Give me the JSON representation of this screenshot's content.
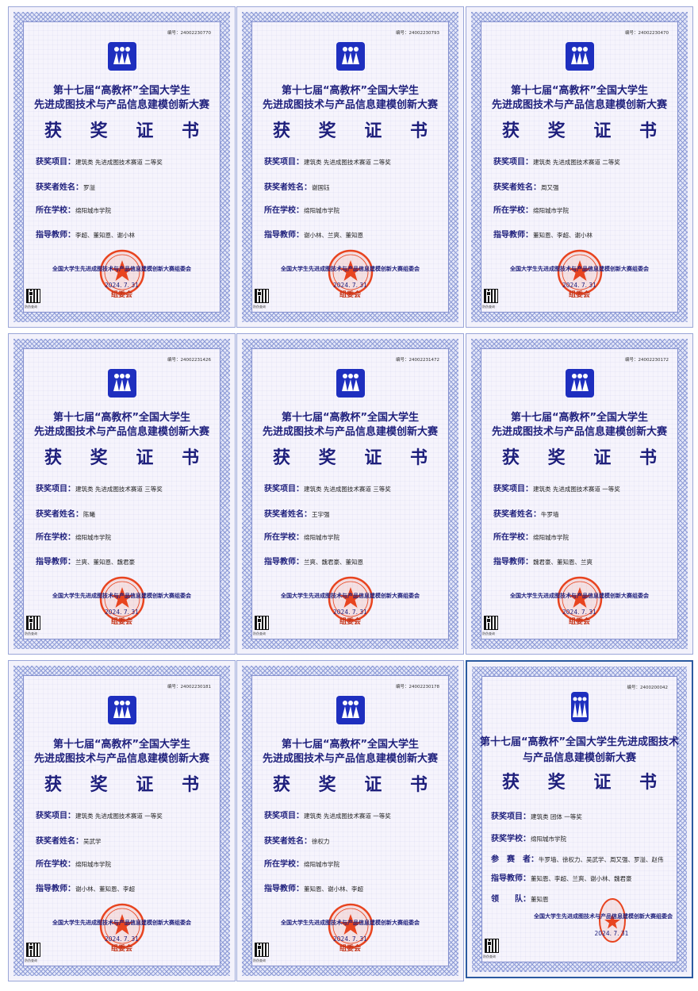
{
  "certificates": [
    {
      "serial": "编号：24002230770",
      "title1": "第十七届“高教杯”全国大学生",
      "title2": "先进成图技术与产品信息建模创新大赛",
      "heading": "获 奖 证 书",
      "item_label": "获奖项目：",
      "item_value": "建筑类 先进成图技术赛道 二等奖",
      "name_label": "获奖者姓名：",
      "name_value": "罗溢",
      "school_label": "所在学校：",
      "school_value": "绵阳城市学院",
      "teacher_label": "指导教师：",
      "teacher_value": "李超、董知恩、谢小林",
      "org": "全国大学生先进成图技术与产品信息建模创新大赛组委会",
      "date": "2024. 7. 31",
      "seal_text": "组委会",
      "qr_label": "防伪查询"
    },
    {
      "serial": "编号：24002230793",
      "title1": "第十七届“高教杯”全国大学生",
      "title2": "先进成图技术与产品信息建模创新大赛",
      "heading": "获 奖 证 书",
      "item_label": "获奖项目：",
      "item_value": "建筑类 先进成图技术赛道 二等奖",
      "name_label": "获奖者姓名：",
      "name_value": "谢国钰",
      "school_label": "所在学校：",
      "school_value": "绵阳城市学院",
      "teacher_label": "指导教师：",
      "teacher_value": "谢小林、兰爽、董知恩",
      "org": "全国大学生先进成图技术与产品信息建模创新大赛组委会",
      "date": "2024. 7. 31",
      "seal_text": "组委会",
      "qr_label": "防伪查询"
    },
    {
      "serial": "编号：24002230470",
      "title1": "第十七届“高教杯”全国大学生",
      "title2": "先进成图技术与产品信息建模创新大赛",
      "heading": "获 奖 证 书",
      "item_label": "获奖项目：",
      "item_value": "建筑类 先进成图技术赛道 二等奖",
      "name_label": "获奖者姓名：",
      "name_value": "周又强",
      "school_label": "所在学校：",
      "school_value": "绵阳城市学院",
      "teacher_label": "指导教师：",
      "teacher_value": "董知恩、李超、谢小林",
      "org": "全国大学生先进成图技术与产品信息建模创新大赛组委会",
      "date": "2024. 7. 31",
      "seal_text": "组委会",
      "qr_label": "防伪查询"
    },
    {
      "serial": "编号：24002231426",
      "title1": "第十七届“高教杯”全国大学生",
      "title2": "先进成图技术与产品信息建模创新大赛",
      "heading": "获 奖 证 书",
      "item_label": "获奖项目：",
      "item_value": "建筑类 先进成图技术赛道 三等奖",
      "name_label": "获奖者姓名：",
      "name_value": "陈曦",
      "school_label": "所在学校：",
      "school_value": "绵阳城市学院",
      "teacher_label": "指导教师：",
      "teacher_value": "兰爽、董知恩、魏君豪",
      "org": "全国大学生先进成图技术与产品信息建模创新大赛组委会",
      "date": "2024. 7. 31",
      "seal_text": "组委会",
      "qr_label": "防伪查询"
    },
    {
      "serial": "编号：24002231472",
      "title1": "第十七届“高教杯”全国大学生",
      "title2": "先进成图技术与产品信息建模创新大赛",
      "heading": "获 奖 证 书",
      "item_label": "获奖项目：",
      "item_value": "建筑类 先进成图技术赛道 三等奖",
      "name_label": "获奖者姓名：",
      "name_value": "王宇强",
      "school_label": "所在学校：",
      "school_value": "绵阳城市学院",
      "teacher_label": "指导教师：",
      "teacher_value": "兰爽、魏君豪、董知恩",
      "org": "全国大学生先进成图技术与产品信息建模创新大赛组委会",
      "date": "2024. 7. 31",
      "seal_text": "组委会",
      "qr_label": "防伪查询"
    },
    {
      "serial": "编号：24002230172",
      "title1": "第十七届“高教杯”全国大学生",
      "title2": "先进成图技术与产品信息建模创新大赛",
      "heading": "获 奖 证 书",
      "item_label": "获奖项目：",
      "item_value": "建筑类 先进成图技术赛道 一等奖",
      "name_label": "获奖者姓名：",
      "name_value": "牛罗墙",
      "school_label": "所在学校：",
      "school_value": "绵阳城市学院",
      "teacher_label": "指导教师：",
      "teacher_value": "魏君豪、董知恩、兰爽",
      "org": "全国大学生先进成图技术与产品信息建模创新大赛组委会",
      "date": "2024. 7. 31",
      "seal_text": "组委会",
      "qr_label": "防伪查询"
    },
    {
      "serial": "编号：24002230181",
      "title1": "第十七届“高教杯”全国大学生",
      "title2": "先进成图技术与产品信息建模创新大赛",
      "heading": "获 奖 证 书",
      "item_label": "获奖项目：",
      "item_value": "建筑类 先进成图技术赛道 一等奖",
      "name_label": "获奖者姓名：",
      "name_value": "吴武学",
      "school_label": "所在学校：",
      "school_value": "绵阳城市学院",
      "teacher_label": "指导教师：",
      "teacher_value": "谢小林、董知恩、李超",
      "org": "全国大学生先进成图技术与产品信息建模创新大赛组委会",
      "date": "2024. 7. 31",
      "seal_text": "组委会",
      "qr_label": "防伪查询"
    },
    {
      "serial": "编号：24002230178",
      "title1": "第十七届“高教杯”全国大学生",
      "title2": "先进成图技术与产品信息建模创新大赛",
      "heading": "获 奖 证 书",
      "item_label": "获奖项目：",
      "item_value": "建筑类 先进成图技术赛道 一等奖",
      "name_label": "获奖者姓名：",
      "name_value": "徐权力",
      "school_label": "所在学校：",
      "school_value": "绵阳城市学院",
      "teacher_label": "指导教师：",
      "teacher_value": "董知恩、谢小林、李超",
      "org": "全国大学生先进成图技术与产品信息建模创新大赛组委会",
      "date": "2024. 7. 31",
      "seal_text": "组委会",
      "qr_label": "防伪查询"
    }
  ],
  "team_certificate": {
    "serial": "编号：2400200042",
    "title1": "第十七届“高教杯”全国大学生先进成图技术",
    "title2": "与产品信息建模创新大赛",
    "heading": "获 奖 证 书",
    "item_label": "获奖项目：",
    "item_value": "建筑类 团体 一等奖",
    "school_label": "获奖学校：",
    "school_value": "绵阳城市学院",
    "members_label": "参　赛　者：",
    "members_value": "牛罗墙、徐权力、吴武学、周又强、罗溢、赵伟",
    "teacher_label": "指导教师：",
    "teacher_value": "董知恩、李超、兰爽、谢小林、魏君豪",
    "leader_label": "领　　队：",
    "leader_value": "董知恩",
    "org": "全国大学生先进成图技术与产品信息建模创新大赛组委会",
    "date": "2024. 7. 31",
    "qr_label": "防伪查询"
  }
}
